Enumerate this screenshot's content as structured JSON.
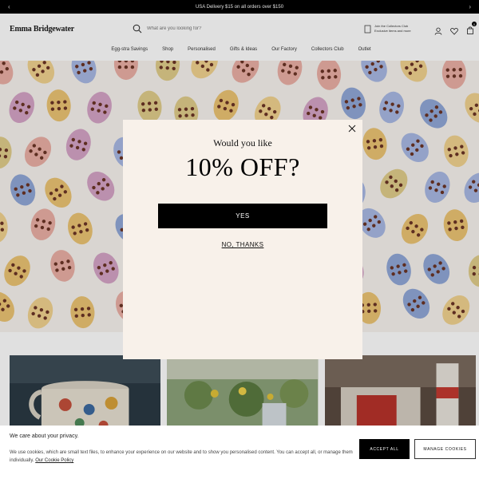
{
  "promo": {
    "text": "USA Delivery $15 on all orders over $150",
    "prev_icon": "chevron-left-icon",
    "next_icon": "chevron-right-icon"
  },
  "header": {
    "logo": "Emma Bridgewater",
    "search_placeholder": "What are you looking for?",
    "club_line1": "Join the Collectors Club",
    "club_line2": "Exclusive items and more",
    "cart_count": "0"
  },
  "nav": {
    "items": [
      "Egg-stra Savings",
      "Shop",
      "Personalised",
      "Gifts & Ideas",
      "Our Factory",
      "Collectors Club",
      "Outlet"
    ]
  },
  "modal": {
    "question": "Would you like",
    "offer": "10% OFF?",
    "yes_label": "YES",
    "no_label": "NO, THANKS"
  },
  "cookie": {
    "title": "We care about your privacy.",
    "body": "We use cookies, which are small text files, to enhance your experience on our website and to show you personalised content. You can accept all, or manage them individually.",
    "link": "Our Cookie Policy",
    "accept_label": "ACCEPT ALL",
    "manage_label": "MANAGE COOKIES"
  }
}
